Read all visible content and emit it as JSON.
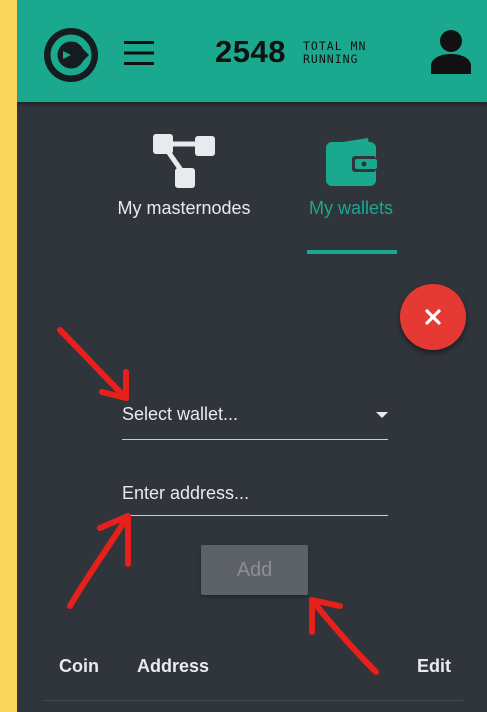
{
  "header": {
    "mn_count": "2548",
    "mn_count_label_line1": "TOTAL MN",
    "mn_count_label_line2": "RUNNING"
  },
  "tabs": [
    {
      "label": "My masternodes",
      "icon": "masternodes-icon",
      "active": false
    },
    {
      "label": "My wallets",
      "icon": "wallet-icon",
      "active": true
    }
  ],
  "form": {
    "wallet_select_value": "Select wallet...",
    "address_placeholder": "Enter address...",
    "add_label": "Add"
  },
  "table": {
    "columns": [
      "Coin",
      "Address",
      "Edit"
    ]
  },
  "colors": {
    "accent": "#1aa88f",
    "background": "#2f353b",
    "danger": "#e53a33",
    "annotation": "#e8201c"
  }
}
